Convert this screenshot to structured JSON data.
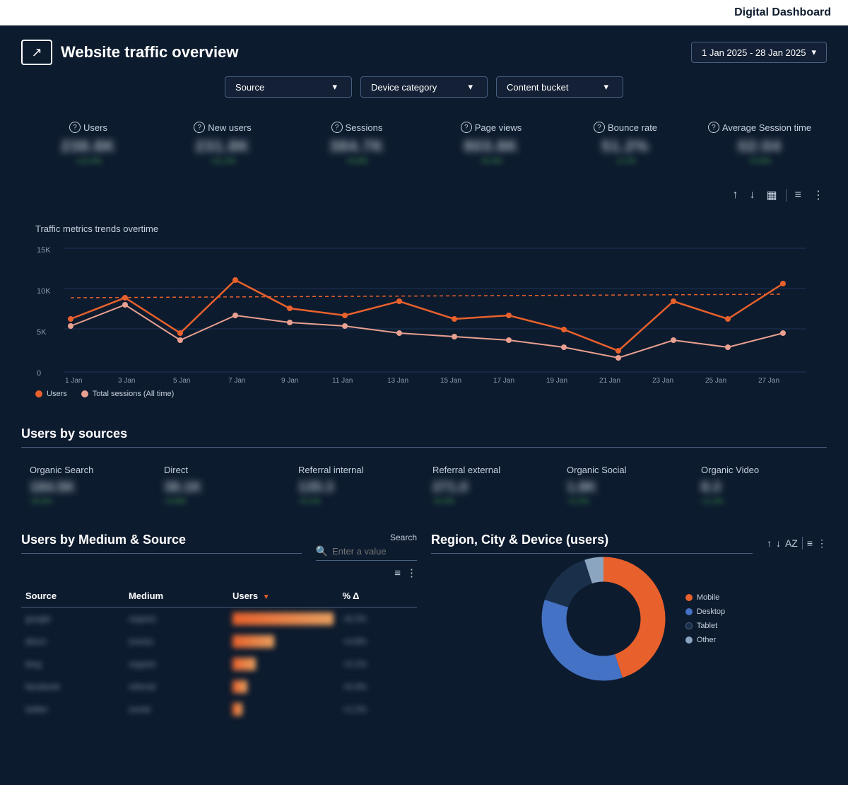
{
  "topbar": {
    "title": "Digital Dashboard"
  },
  "header": {
    "title": "Website traffic overview",
    "icon": "↗",
    "date_range": "1 Jan 2025 - 28 Jan 2025"
  },
  "filters": [
    {
      "label": "Source",
      "id": "source"
    },
    {
      "label": "Device category",
      "id": "device-category"
    },
    {
      "label": "Content bucket",
      "id": "content-bucket"
    }
  ],
  "metrics": [
    {
      "label": "Users",
      "value": "238.8K",
      "change": "+12.4%"
    },
    {
      "label": "New users",
      "value": "231.8K",
      "change": "+11.2%"
    },
    {
      "label": "Sessions",
      "value": "384.7K",
      "change": "+9.8%"
    },
    {
      "label": "Page views",
      "value": "803.8K",
      "change": "+8.3%"
    },
    {
      "label": "Bounce rate",
      "value": "51.2%",
      "change": "-2.1%"
    },
    {
      "label": "Average Session time",
      "value": "02:04",
      "change": "+5.6%"
    }
  ],
  "chart": {
    "title": "Traffic metrics trends overtime",
    "y_labels": [
      "15K",
      "10K",
      "5K",
      "0"
    ],
    "x_labels": [
      "1 Jan",
      "3 Jan",
      "5 Jan",
      "7 Jan",
      "9 Jan",
      "11 Jan",
      "13 Jan",
      "15 Jan",
      "17 Jan",
      "19 Jan",
      "21 Jan",
      "23 Jan",
      "25 Jan",
      "27 Jan"
    ],
    "legend": [
      {
        "label": "Users",
        "color": "#e8612c"
      },
      {
        "label": "Total sessions (All time)",
        "color": "#e8a090"
      }
    ]
  },
  "sources": {
    "title": "Users by sources",
    "items": [
      {
        "label": "Organic Search",
        "value": "184.5K",
        "change": "+9.2%"
      },
      {
        "label": "Direct",
        "value": "38.1K",
        "change": "+4.8%"
      },
      {
        "label": "Referral internal",
        "value": "135.3",
        "change": "+3.1%"
      },
      {
        "label": "Referral external",
        "value": "271.0",
        "change": "+6.4%"
      },
      {
        "label": "Organic Social",
        "value": "1.8K",
        "change": "+2.2%"
      },
      {
        "label": "Organic Video",
        "value": "8.3",
        "change": "+1.1%"
      }
    ]
  },
  "medium_source_table": {
    "title": "Users by Medium & Source",
    "search_label": "Search",
    "search_placeholder": "Enter a value",
    "columns": [
      "Source",
      "Medium",
      "Users",
      "% Δ"
    ],
    "rows": [
      {
        "source": "google",
        "medium": "organic",
        "users": "92,341",
        "delta": "+8.2%"
      },
      {
        "source": "direct",
        "medium": "(none)",
        "users": "38,100",
        "delta": "+4.8%"
      },
      {
        "source": "bing",
        "medium": "organic",
        "users": "21,450",
        "delta": "+3.1%"
      },
      {
        "source": "facebook",
        "medium": "referral",
        "users": "14,230",
        "delta": "+6.4%"
      },
      {
        "source": "twitter",
        "medium": "social",
        "users": "8,920",
        "delta": "+2.2%"
      }
    ]
  },
  "region_card": {
    "title": "Region, City & Device (users)",
    "donut_segments": [
      {
        "label": "Mobile",
        "color": "#e8612c",
        "value": 45
      },
      {
        "label": "Desktop",
        "color": "#4472c4",
        "value": 35
      },
      {
        "label": "Tablet",
        "color": "#1a2f4a",
        "value": 15
      },
      {
        "label": "Other",
        "color": "#8ba4c0",
        "value": 5
      }
    ]
  },
  "toolbar": {
    "upload_icon": "↑",
    "download_icon": "↓",
    "chart_icon": "▦",
    "filter_icon": "≡",
    "more_icon": "⋮"
  }
}
